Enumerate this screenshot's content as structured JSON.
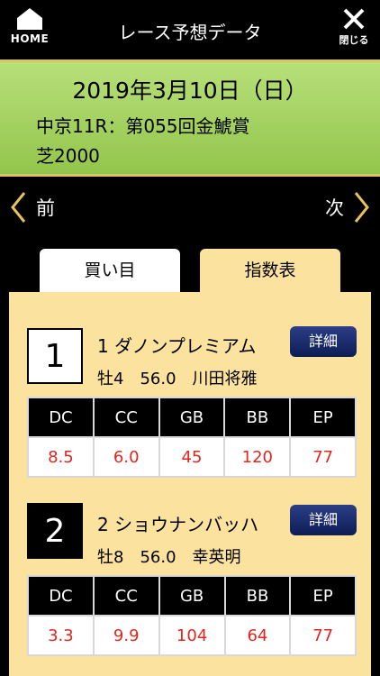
{
  "header": {
    "home_label": "HOME",
    "title": "レース予想データ",
    "close_label": "閉じる"
  },
  "race": {
    "date": "2019年3月10日（日）",
    "name": "中京11R：第055回金鯱賞",
    "course": "芝2000"
  },
  "nav": {
    "prev_label": "前",
    "next_label": "次"
  },
  "tabs": [
    {
      "label": "買い目",
      "active": false
    },
    {
      "label": "指数表",
      "active": true
    }
  ],
  "table_headers": [
    "DC",
    "CC",
    "GB",
    "BB",
    "EP"
  ],
  "detail_label": "詳細",
  "entries": [
    {
      "number": "1",
      "name": "1 ダノンプレミアム",
      "detail": "牡4　56.0　川田将雅",
      "values": [
        "8.5",
        "6.0",
        "45",
        "120",
        "77"
      ]
    },
    {
      "number": "2",
      "name": "2 ショウナンバッハ",
      "detail": "牡8　56.0　幸英明",
      "values": [
        "3.3",
        "9.9",
        "104",
        "64",
        "77"
      ]
    }
  ],
  "colors": {
    "race_bg": "#a6d262",
    "panel_bg": "#fbe29e",
    "value_red": "#e0261f",
    "detail_btn": "#1a2b6b"
  }
}
